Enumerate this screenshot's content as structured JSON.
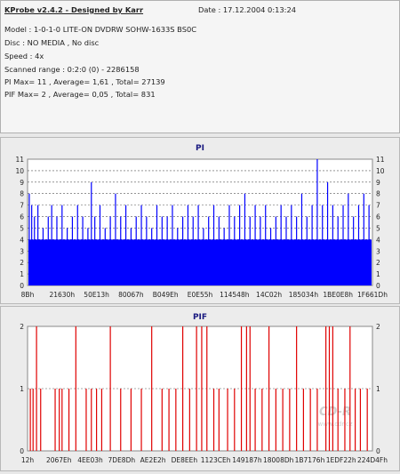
{
  "app": {
    "title": "KProbe v2.4.2 - Designed by Karr",
    "date": "Date : 17.12.2004 0:13:24"
  },
  "info": {
    "model": "Model : 1-0-1-0 LITE-ON DVDRW SOHW-1633S BS0C",
    "disc": "Disc : NO MEDIA , No disc",
    "speed": "Speed : 4x",
    "range": "Scanned range : 0:2:0 (0) - 2286158",
    "pi": "PI Max= 11 , Average= 1,61 , Total= 27139",
    "pif": "PIF Max= 2 , Average= 0,05 , Total= 831"
  },
  "watermark": {
    "logo": "CD-R",
    "url": "www.cdr.cz"
  },
  "chart_data": [
    {
      "type": "bar",
      "title": "PI",
      "color": "#0000ff",
      "ylim": [
        0,
        11
      ],
      "yticks": [
        "0",
        "1",
        "2",
        "3",
        "4",
        "5",
        "6",
        "7",
        "8",
        "9",
        "10",
        "11"
      ],
      "xticks": [
        "8Bh",
        "21630h",
        "50E13h",
        "80067h",
        "B049Eh",
        "E0E55h",
        "114548h",
        "14C02h",
        "185034h",
        "1BE0E8h",
        "1F661Dh"
      ],
      "baseline": 4,
      "spikes": [
        [
          0.005,
          8
        ],
        [
          0.012,
          7
        ],
        [
          0.02,
          6
        ],
        [
          0.03,
          7
        ],
        [
          0.045,
          5
        ],
        [
          0.06,
          6
        ],
        [
          0.07,
          7
        ],
        [
          0.085,
          6
        ],
        [
          0.1,
          7
        ],
        [
          0.115,
          5
        ],
        [
          0.13,
          6
        ],
        [
          0.145,
          7
        ],
        [
          0.16,
          6
        ],
        [
          0.175,
          5
        ],
        [
          0.185,
          9
        ],
        [
          0.195,
          6
        ],
        [
          0.21,
          7
        ],
        [
          0.225,
          5
        ],
        [
          0.24,
          6
        ],
        [
          0.255,
          8
        ],
        [
          0.27,
          6
        ],
        [
          0.285,
          7
        ],
        [
          0.3,
          5
        ],
        [
          0.315,
          6
        ],
        [
          0.33,
          7
        ],
        [
          0.345,
          6
        ],
        [
          0.36,
          5
        ],
        [
          0.375,
          7
        ],
        [
          0.39,
          6
        ],
        [
          0.405,
          6
        ],
        [
          0.42,
          7
        ],
        [
          0.435,
          5
        ],
        [
          0.45,
          6
        ],
        [
          0.465,
          7
        ],
        [
          0.48,
          6
        ],
        [
          0.495,
          7
        ],
        [
          0.51,
          5
        ],
        [
          0.525,
          6
        ],
        [
          0.54,
          7
        ],
        [
          0.555,
          6
        ],
        [
          0.57,
          5
        ],
        [
          0.585,
          7
        ],
        [
          0.6,
          6
        ],
        [
          0.615,
          7
        ],
        [
          0.63,
          8
        ],
        [
          0.645,
          6
        ],
        [
          0.66,
          7
        ],
        [
          0.675,
          6
        ],
        [
          0.69,
          7
        ],
        [
          0.705,
          5
        ],
        [
          0.72,
          6
        ],
        [
          0.735,
          7
        ],
        [
          0.75,
          6
        ],
        [
          0.765,
          7
        ],
        [
          0.78,
          6
        ],
        [
          0.795,
          8
        ],
        [
          0.81,
          6
        ],
        [
          0.825,
          7
        ],
        [
          0.84,
          11
        ],
        [
          0.855,
          7
        ],
        [
          0.87,
          9
        ],
        [
          0.885,
          7
        ],
        [
          0.9,
          6
        ],
        [
          0.915,
          7
        ],
        [
          0.93,
          8
        ],
        [
          0.945,
          6
        ],
        [
          0.96,
          7
        ],
        [
          0.975,
          8
        ],
        [
          0.99,
          7
        ]
      ]
    },
    {
      "type": "bar",
      "title": "PIF",
      "color": "#e00000",
      "ylim": [
        0,
        2
      ],
      "yticks": [
        "0",
        "1",
        "2"
      ],
      "xticks": [
        "12h",
        "2067Eh",
        "4EE03h",
        "7DE8Dh",
        "AE2E2h",
        "DE8EEh",
        "1123CEh",
        "149187h",
        "18008Dh",
        "1B7176h",
        "1EDF22h",
        "224D4Fh"
      ],
      "spikes": [
        [
          0.008,
          1
        ],
        [
          0.016,
          1
        ],
        [
          0.026,
          2
        ],
        [
          0.038,
          1
        ],
        [
          0.08,
          1
        ],
        [
          0.092,
          1
        ],
        [
          0.1,
          1
        ],
        [
          0.12,
          1
        ],
        [
          0.14,
          2
        ],
        [
          0.17,
          1
        ],
        [
          0.185,
          1
        ],
        [
          0.2,
          1
        ],
        [
          0.215,
          1
        ],
        [
          0.24,
          2
        ],
        [
          0.27,
          1
        ],
        [
          0.3,
          1
        ],
        [
          0.33,
          1
        ],
        [
          0.36,
          2
        ],
        [
          0.39,
          1
        ],
        [
          0.41,
          1
        ],
        [
          0.43,
          1
        ],
        [
          0.45,
          2
        ],
        [
          0.47,
          1
        ],
        [
          0.49,
          2
        ],
        [
          0.505,
          2
        ],
        [
          0.52,
          2
        ],
        [
          0.54,
          1
        ],
        [
          0.555,
          1
        ],
        [
          0.58,
          1
        ],
        [
          0.6,
          1
        ],
        [
          0.62,
          2
        ],
        [
          0.635,
          2
        ],
        [
          0.645,
          2
        ],
        [
          0.66,
          1
        ],
        [
          0.68,
          1
        ],
        [
          0.7,
          2
        ],
        [
          0.72,
          1
        ],
        [
          0.74,
          1
        ],
        [
          0.76,
          1
        ],
        [
          0.78,
          2
        ],
        [
          0.8,
          1
        ],
        [
          0.82,
          1
        ],
        [
          0.84,
          1
        ],
        [
          0.865,
          2
        ],
        [
          0.875,
          2
        ],
        [
          0.885,
          2
        ],
        [
          0.9,
          1
        ],
        [
          0.92,
          1
        ],
        [
          0.935,
          2
        ],
        [
          0.95,
          1
        ],
        [
          0.965,
          1
        ],
        [
          0.985,
          1
        ]
      ]
    }
  ]
}
